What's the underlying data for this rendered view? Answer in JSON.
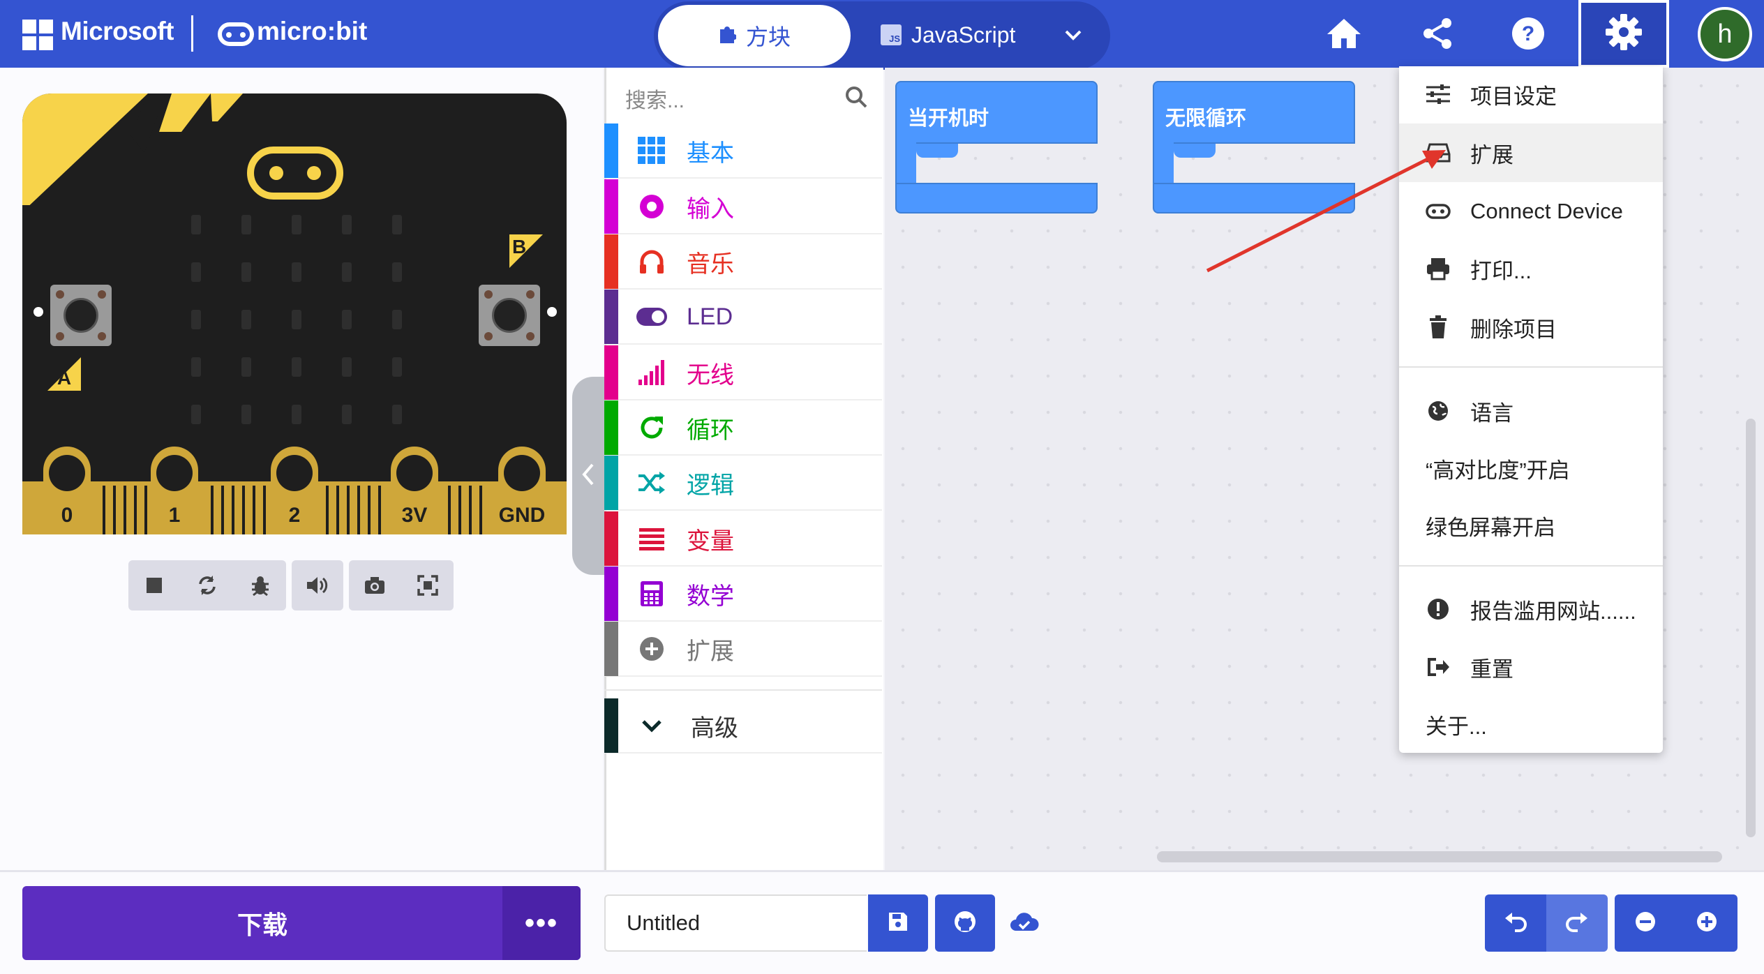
{
  "header": {
    "brand": "Microsoft",
    "product": "micro:bit",
    "tabs": {
      "blocks": "方块",
      "javascript": "JavaScript"
    },
    "avatar_initial": "h"
  },
  "simulator": {
    "pins": [
      "0",
      "1",
      "2",
      "3V",
      "GND"
    ],
    "button_a": "A",
    "button_b": "B"
  },
  "toolbox": {
    "search_placeholder": "搜索...",
    "categories": [
      {
        "label": "基本",
        "color": "#1e90ff",
        "icon": "grid-icon"
      },
      {
        "label": "输入",
        "color": "#d400d4",
        "icon": "input-circle-icon"
      },
      {
        "label": "音乐",
        "color": "#e63022",
        "icon": "headphones-icon"
      },
      {
        "label": "LED",
        "color": "#5c2d91",
        "icon": "toggle-icon"
      },
      {
        "label": "无线",
        "color": "#e3008c",
        "icon": "signal-icon"
      },
      {
        "label": "循环",
        "color": "#00aa00",
        "icon": "refresh-icon"
      },
      {
        "label": "逻辑",
        "color": "#00a4a6",
        "icon": "shuffle-icon"
      },
      {
        "label": "变量",
        "color": "#dc143c",
        "icon": "list-icon"
      },
      {
        "label": "数学",
        "color": "#9400d3",
        "icon": "calculator-icon"
      },
      {
        "label": "扩展",
        "color": "#777777",
        "icon": "plus-circle-icon"
      }
    ],
    "advanced": "高级"
  },
  "workspace": {
    "blocks": [
      {
        "label": "当开机时"
      },
      {
        "label": "无限循环"
      }
    ]
  },
  "settings_menu": {
    "items": [
      {
        "label": "项目设定",
        "icon": "sliders-icon"
      },
      {
        "label": "扩展",
        "icon": "extensions-icon"
      },
      {
        "label": "Connect Device",
        "icon": "device-icon"
      },
      {
        "label": "打印...",
        "icon": "print-icon"
      },
      {
        "label": "删除项目",
        "icon": "trash-icon"
      },
      {
        "label": "语言",
        "icon": "globe-icon"
      },
      {
        "label": "“高对比度”开启"
      },
      {
        "label": "绿色屏幕开启"
      },
      {
        "label": "报告滥用网站......",
        "icon": "alert-icon"
      },
      {
        "label": "重置",
        "icon": "signout-icon"
      },
      {
        "label": "关于..."
      }
    ]
  },
  "bottom": {
    "download": "下载",
    "more": "•••",
    "project_name": "Untitled"
  },
  "colors": {
    "header": "#3454d1",
    "download": "#5c2dc0",
    "block": "#4c97ff"
  }
}
